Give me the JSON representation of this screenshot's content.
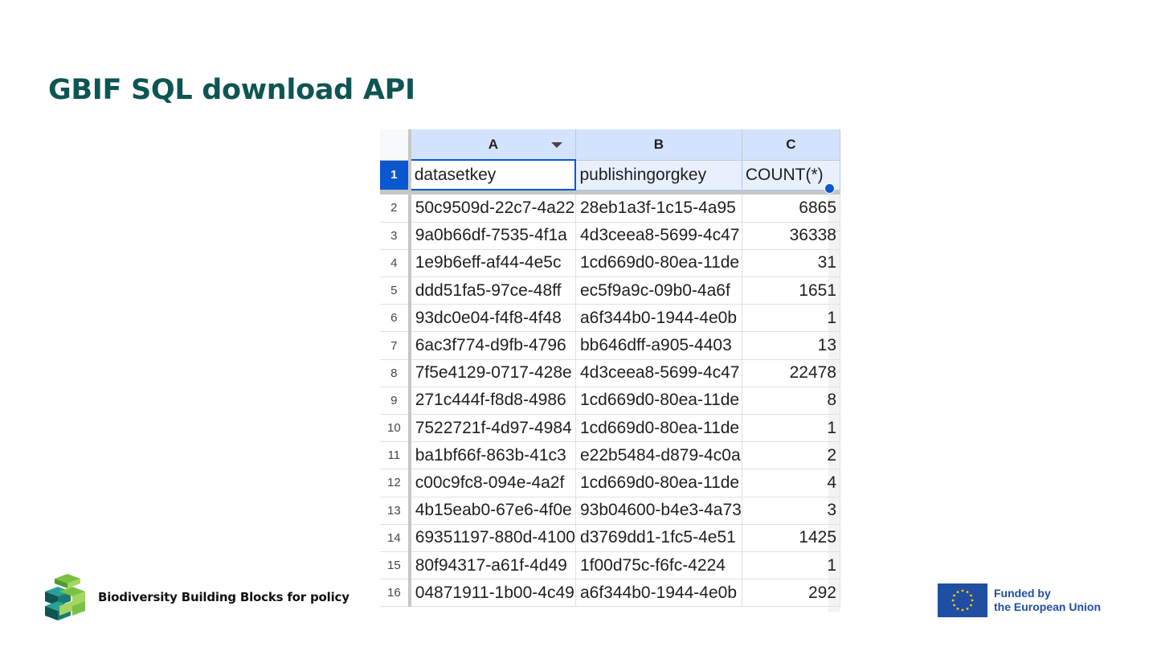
{
  "slide": {
    "title": "GBIF SQL download API"
  },
  "sheet": {
    "columns": [
      "A",
      "B",
      "C"
    ],
    "header_row": {
      "number": "1",
      "cells": [
        "datasetkey",
        "publishingorgkey",
        "COUNT(*)"
      ]
    },
    "rows": [
      {
        "n": "2",
        "a": "50c9509d-22c7-4a22",
        "b": "28eb1a3f-1c15-4a95",
        "c": "6865"
      },
      {
        "n": "3",
        "a": "9a0b66df-7535-4f1a",
        "b": "4d3ceea8-5699-4c47",
        "c": "36338"
      },
      {
        "n": "4",
        "a": "1e9b6eff-af44-4e5c",
        "b": "1cd669d0-80ea-11de",
        "c": "31"
      },
      {
        "n": "5",
        "a": "ddd51fa5-97ce-48ff",
        "b": "ec5f9a9c-09b0-4a6f",
        "c": "1651"
      },
      {
        "n": "6",
        "a": "93dc0e04-f4f8-4f48",
        "b": "a6f344b0-1944-4e0b",
        "c": "1"
      },
      {
        "n": "7",
        "a": "6ac3f774-d9fb-4796",
        "b": "bb646dff-a905-4403",
        "c": "13"
      },
      {
        "n": "8",
        "a": "7f5e4129-0717-428e",
        "b": "4d3ceea8-5699-4c47",
        "c": "22478"
      },
      {
        "n": "9",
        "a": "271c444f-f8d8-4986",
        "b": "1cd669d0-80ea-11de",
        "c": "8"
      },
      {
        "n": "10",
        "a": "7522721f-4d97-4984",
        "b": "1cd669d0-80ea-11de",
        "c": "1"
      },
      {
        "n": "11",
        "a": "ba1bf66f-863b-41c3",
        "b": "e22b5484-d879-4c0a",
        "c": "2"
      },
      {
        "n": "12",
        "a": "c00c9fc8-094e-4a2f",
        "b": "1cd669d0-80ea-11de",
        "c": "4"
      },
      {
        "n": "13",
        "a": "4b15eab0-67e6-4f0e",
        "b": "93b04600-b4e3-4a73",
        "c": "3"
      },
      {
        "n": "14",
        "a": "69351197-880d-4100",
        "b": "d3769dd1-1fc5-4e51",
        "c": "1425"
      },
      {
        "n": "15",
        "a": "80f94317-a61f-4d49",
        "b": "1f00d75c-f6fc-4224",
        "c": "1"
      },
      {
        "n": "16",
        "a": "04871911-1b00-4c49",
        "b": "a6f344b0-1944-4e0b",
        "c": "292"
      }
    ]
  },
  "footer": {
    "brand_text": "Biodiversity Building Blocks for policy",
    "eu_line1": "Funded by",
    "eu_line2": "the European Union"
  },
  "colors": {
    "title": "#0d5553",
    "selection": "#0b57d0",
    "eu_blue": "#1f4ea3",
    "logo_green": "#7ac143",
    "logo_teal": "#0d5553"
  },
  "icons": [
    "dropdown-arrow-icon",
    "b-cube-logo",
    "eu-flag-icon"
  ]
}
